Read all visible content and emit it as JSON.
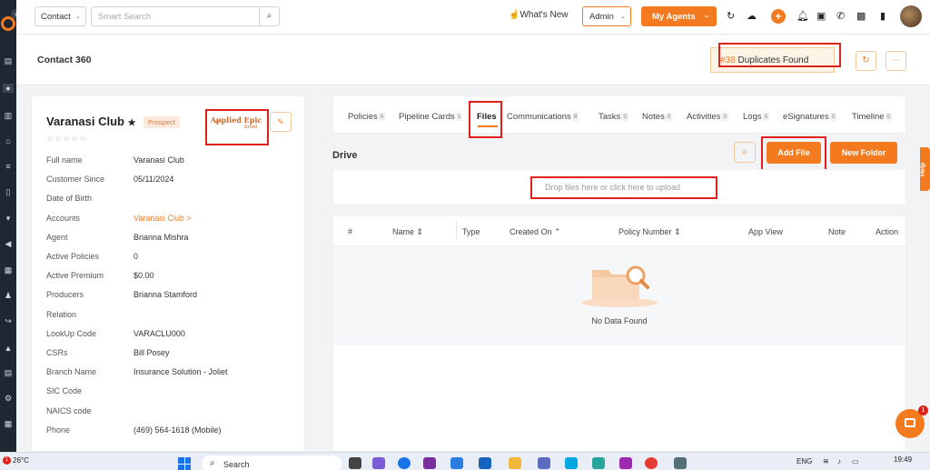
{
  "topbar": {
    "contact_select": "Contact",
    "search_placeholder": "Smart Search",
    "whats_new": "What's New",
    "admin_select": "Admin",
    "my_agents": "My Agents"
  },
  "header": {
    "title": "Contact 360",
    "duplicates_count": "#38",
    "duplicates_label": "Duplicates Found"
  },
  "contact": {
    "name": "Varanasi Club",
    "status": "Prospect",
    "applied_title": "Applied Epic",
    "applied_sub": "Email",
    "fields": [
      {
        "label": "Full name",
        "value": "Varanasi Club"
      },
      {
        "label": "Customer Since",
        "value": "05/11/2024"
      },
      {
        "label": "Date of Birth",
        "value": ""
      },
      {
        "label": "Accounts",
        "value": "Varanasi Club >"
      },
      {
        "label": "Agent",
        "value": "Brianna Mishra"
      },
      {
        "label": "Active Policies",
        "value": "0"
      },
      {
        "label": "Active Premium",
        "value": "$0.00"
      },
      {
        "label": "Producers",
        "value": "Brianna Stamford"
      },
      {
        "label": "Relation",
        "value": ""
      },
      {
        "label": "LookUp Code",
        "value": "VARACLU000"
      },
      {
        "label": "CSRs",
        "value": "Bill Posey"
      },
      {
        "label": "Branch Name",
        "value": "Insurance Solution - Joliet"
      },
      {
        "label": "SIC Code",
        "value": ""
      },
      {
        "label": "NAICS code",
        "value": ""
      },
      {
        "label": "Phone",
        "value": "(469) 564-1618 (Mobile)"
      }
    ]
  },
  "tabs": [
    {
      "label": "Policies",
      "count": "0"
    },
    {
      "label": "Pipeline Cards",
      "count": "1"
    },
    {
      "label": "Files",
      "count": ""
    },
    {
      "label": "Communications",
      "count": "8"
    },
    {
      "label": "Tasks",
      "count": "3"
    },
    {
      "label": "Notes",
      "count": "0"
    },
    {
      "label": "Activities",
      "count": "0"
    },
    {
      "label": "Logs",
      "count": "0"
    },
    {
      "label": "eSignatures",
      "count": "0"
    },
    {
      "label": "Timeline",
      "count": "0"
    }
  ],
  "drive": {
    "title": "Drive",
    "add_file": "Add File",
    "new_folder": "New Folder",
    "drop_text": "Drop files here or click here to upload",
    "columns": [
      "#",
      "Name",
      "Type",
      "Created On",
      "Policy Number",
      "App View",
      "Note",
      "Action"
    ],
    "empty": "No Data Found"
  },
  "help_label": "Help",
  "chat_badge": "1",
  "taskbar": {
    "weather_badge": "1",
    "temperature": "26°C",
    "search": "Search",
    "lang": "ENG",
    "time": "19:49"
  },
  "colors": {
    "accent": "#f47a20",
    "highlight": "#e0201a",
    "rail": "#1f2733"
  }
}
